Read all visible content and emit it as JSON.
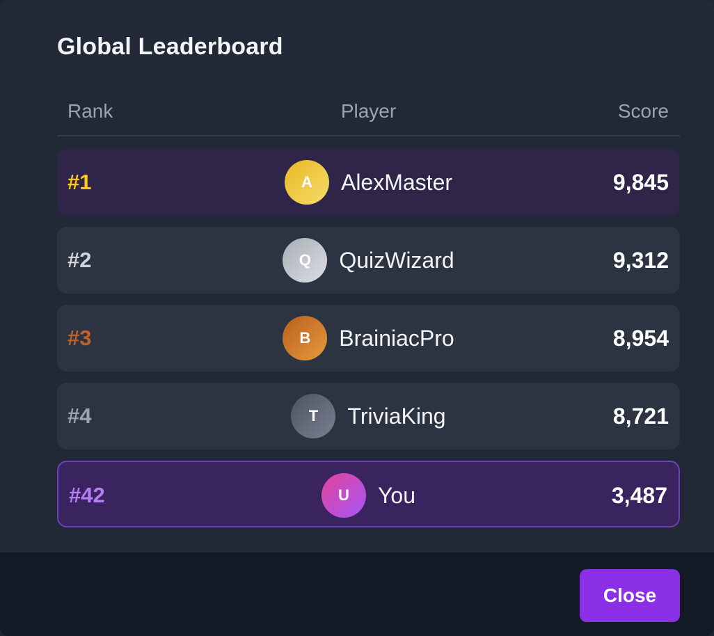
{
  "modal": {
    "title": "Global Leaderboard",
    "close_label": "Close"
  },
  "table": {
    "headers": {
      "rank": "Rank",
      "player": "Player",
      "score": "Score"
    },
    "rows": [
      {
        "rank": "#1",
        "initial": "A",
        "name": "AlexMaster",
        "score": "9,845",
        "rank_color": "#facc15",
        "avatar_gradient": [
          "#e8b825",
          "#f6dc6a"
        ]
      },
      {
        "rank": "#2",
        "initial": "Q",
        "name": "QuizWizard",
        "score": "9,312",
        "rank_color": "#d1d5db",
        "avatar_gradient": [
          "#a9adb5",
          "#dcdfe4"
        ]
      },
      {
        "rank": "#3",
        "initial": "B",
        "name": "BrainiacPro",
        "score": "8,954",
        "rank_color": "#c0622d",
        "avatar_gradient": [
          "#b8601e",
          "#e79a3c"
        ]
      },
      {
        "rank": "#4",
        "initial": "T",
        "name": "TriviaKing",
        "score": "8,721",
        "rank_color": "#9ca3af",
        "avatar_gradient": [
          "#4b5260",
          "#7b8190"
        ]
      },
      {
        "rank": "#42",
        "initial": "U",
        "name": "You",
        "score": "3,487",
        "rank_color": "#b57ef5",
        "avatar_gradient": [
          "#e0459a",
          "#a855f7"
        ]
      }
    ]
  },
  "colors": {
    "accent": "#8b30e6",
    "modal_bg": "#212836",
    "footer_bg": "#141926"
  }
}
